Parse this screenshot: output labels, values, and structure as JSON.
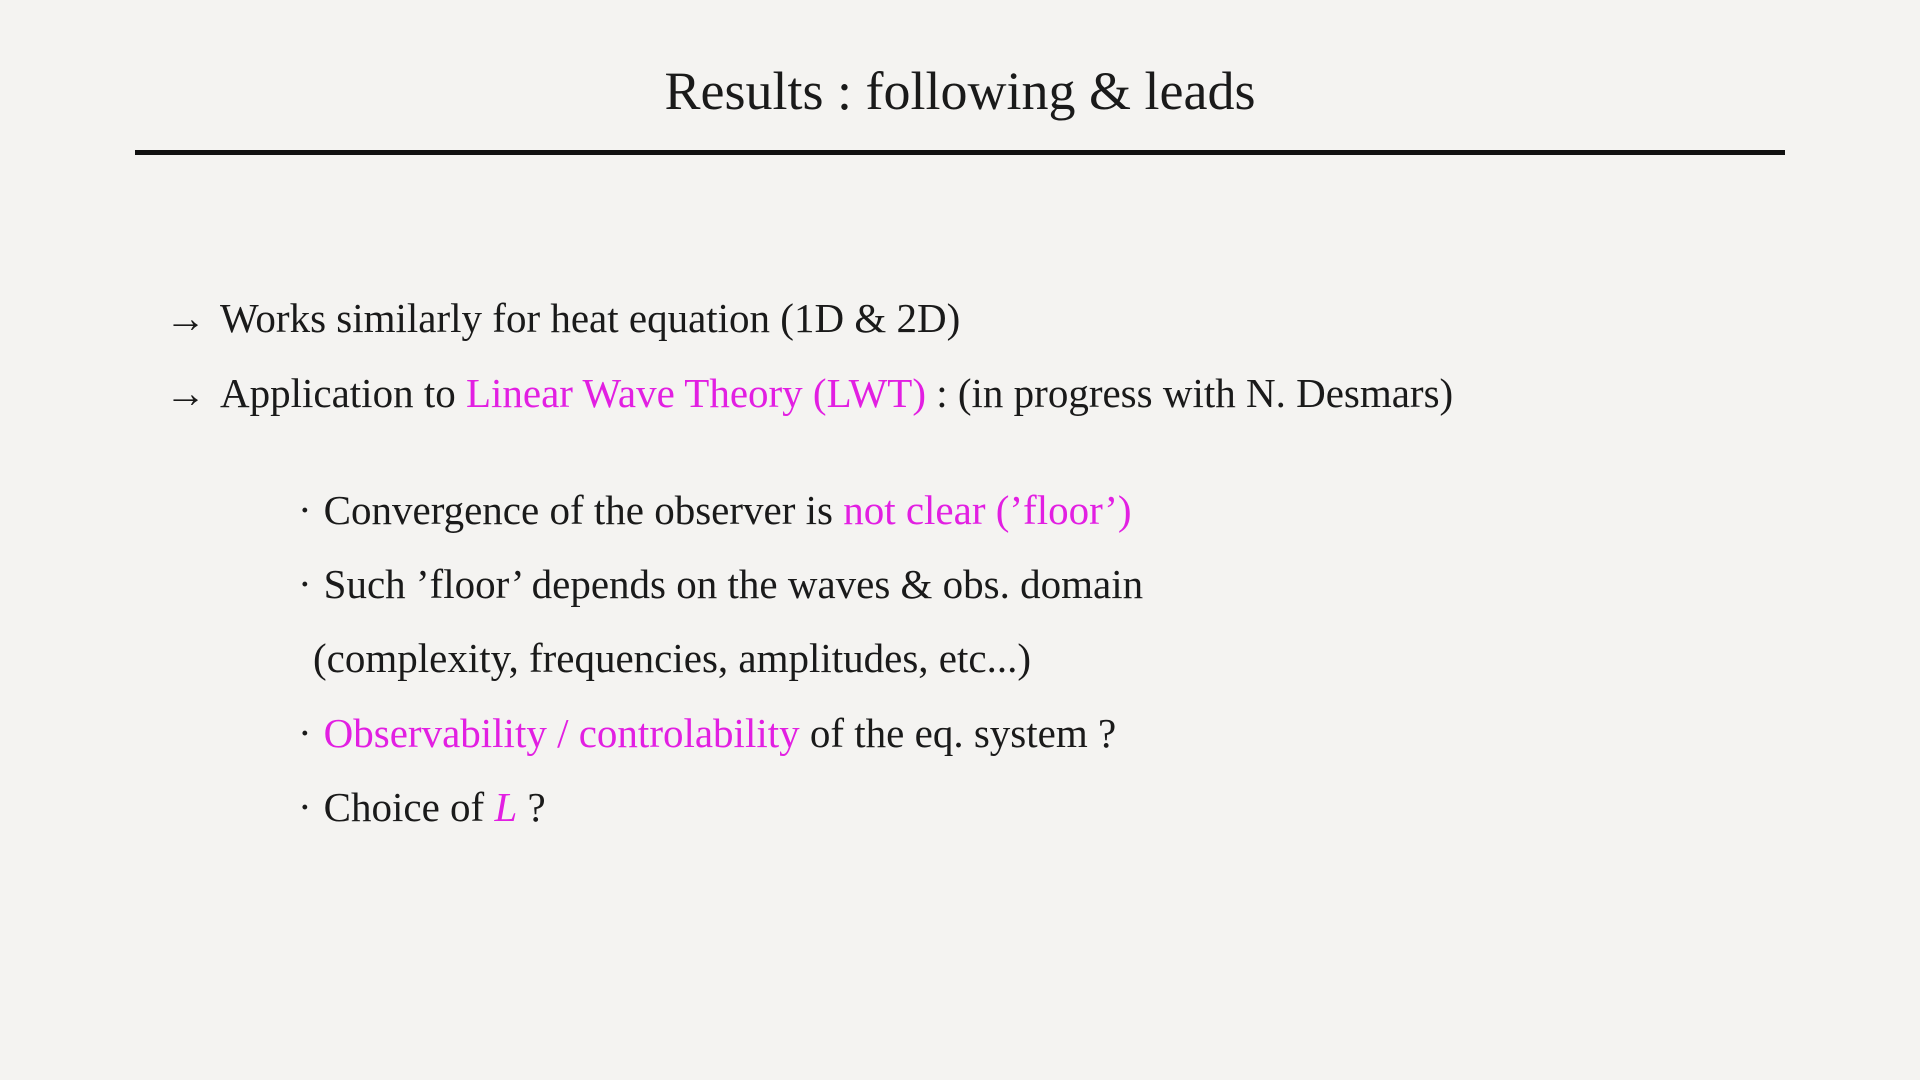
{
  "slide": {
    "title": "Results : following & leads",
    "arrow_glyph": "→",
    "bullet_glyph": "·",
    "accent_color": "#e21fe2",
    "items": [
      {
        "text_before": "Works similarly for heat equation (1D & 2D)"
      },
      {
        "text_before": "Application to ",
        "highlight": "Linear Wave Theory (LWT)",
        "text_after": " : (in progress with N. Desmars)"
      }
    ],
    "subitems": [
      {
        "text_before": "Convergence of the observer is ",
        "highlight": "not clear (’floor’)"
      },
      {
        "text_before": "Such ’floor’ depends on the waves & obs. domain",
        "continuation": "(complexity, frequencies, amplitudes, etc...)"
      },
      {
        "highlight": "Observability / controlability",
        "text_after": " of the eq. system ?"
      },
      {
        "text_before": "Choice of ",
        "highlight": "L",
        "text_after": " ?"
      }
    ]
  }
}
